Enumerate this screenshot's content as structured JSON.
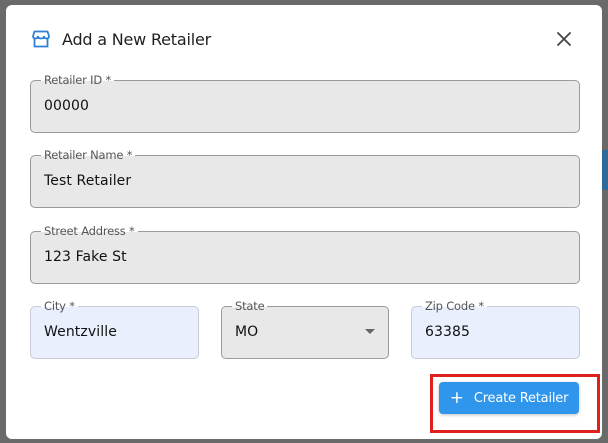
{
  "modal": {
    "title": "Add a New Retailer",
    "icon": "store-icon",
    "close_icon": "close-icon"
  },
  "form": {
    "retailer_id": {
      "label": "Retailer ID *",
      "value": "00000"
    },
    "retailer_name": {
      "label": "Retailer Name *",
      "value": "Test Retailer"
    },
    "street_address": {
      "label": "Street Address *",
      "value": "123 Fake St"
    },
    "city": {
      "label": "City *",
      "value": "Wentzville"
    },
    "state": {
      "label": "State",
      "value": "MO"
    },
    "zip_code": {
      "label": "Zip Code *",
      "value": "63385"
    }
  },
  "actions": {
    "create_label": "Create Retailer",
    "create_icon": "plus-icon",
    "plus_glyph": "+"
  },
  "colors": {
    "accent": "#2f96ec",
    "highlight": "#e0201c"
  }
}
